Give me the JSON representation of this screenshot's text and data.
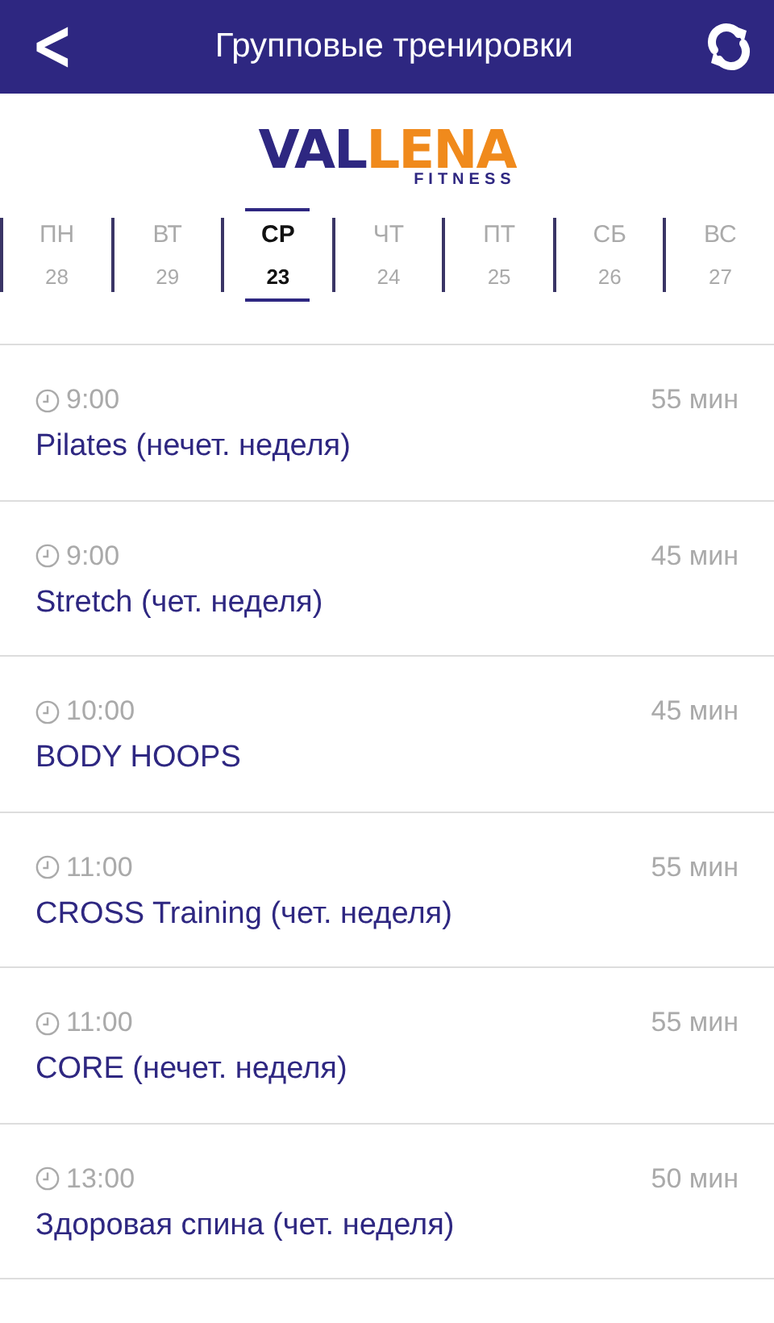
{
  "header": {
    "back": "<",
    "title": "Групповые тренировки"
  },
  "logo": {
    "lead": "VAL",
    "rest": "LENA",
    "tagline": "FITNESS"
  },
  "days": [
    {
      "name": "ПН",
      "date": "28",
      "selected": false
    },
    {
      "name": "ВТ",
      "date": "29",
      "selected": false
    },
    {
      "name": "СР",
      "date": "23",
      "selected": true
    },
    {
      "name": "ЧТ",
      "date": "24",
      "selected": false
    },
    {
      "name": "ПТ",
      "date": "25",
      "selected": false
    },
    {
      "name": "СБ",
      "date": "26",
      "selected": false
    },
    {
      "name": "ВС",
      "date": "27",
      "selected": false
    }
  ],
  "classes": [
    {
      "time": "9:00",
      "duration": "55 мин",
      "title": "Pilates (нечет. неделя)"
    },
    {
      "time": "9:00",
      "duration": "45 мин",
      "title": "Stretch (чет. неделя)"
    },
    {
      "time": "10:00",
      "duration": "45 мин",
      "title": "BODY HOOPS"
    },
    {
      "time": "11:00",
      "duration": "55 мин",
      "title": "CROSS Training (чет. неделя)"
    },
    {
      "time": "11:00",
      "duration": "55 мин",
      "title": "CORE (нечет. неделя)"
    },
    {
      "time": "13:00",
      "duration": "50 мин",
      "title": "Здоровая спина (чет. неделя)"
    }
  ]
}
